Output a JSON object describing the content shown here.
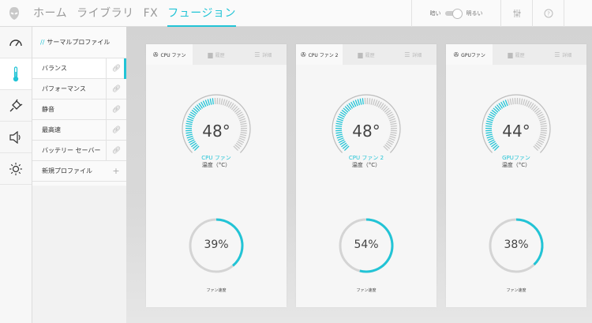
{
  "nav": {
    "items": [
      "ホーム",
      "ライブラリ",
      "FX",
      "フュージョン"
    ],
    "active_index": 3
  },
  "brightness": {
    "dark_label": "暗い",
    "bright_label": "明るい"
  },
  "profiles": {
    "title": "サーマルプロファイル",
    "items": [
      "バランス",
      "パフォーマンス",
      "静音",
      "最高速",
      "バッテリー セーバー",
      "新規プロファイル"
    ],
    "active_index": 0
  },
  "panels": [
    {
      "tabs": [
        "CPU ファン",
        "履歴",
        "詳細"
      ],
      "temp": "48°",
      "temp_value": 48,
      "name": "CPU ファン",
      "unit": "温度（°C）",
      "speed": "39%",
      "speed_value": 39,
      "speed_label": "ファン速度"
    },
    {
      "tabs": [
        "CPU ファン 2",
        "履歴",
        "詳細"
      ],
      "temp": "48°",
      "temp_value": 48,
      "name": "CPU ファン 2",
      "unit": "温度（°C）",
      "speed": "54%",
      "speed_value": 54,
      "speed_label": "ファン速度"
    },
    {
      "tabs": [
        "GPUファン",
        "履歴",
        "詳細"
      ],
      "temp": "44°",
      "temp_value": 44,
      "name": "GPUファン",
      "unit": "温度（°C）",
      "speed": "38%",
      "speed_value": 38,
      "speed_label": "ファン速度"
    }
  ],
  "colors": {
    "accent": "#22c4d6",
    "track": "#d4d4d4"
  },
  "icons": {
    "logo": "alien-head-icon",
    "sidebar": [
      "speedometer-icon",
      "thermometer-icon",
      "plug-icon",
      "speaker-icon",
      "sun-icon"
    ],
    "top_right": [
      "sliders-icon",
      "help-icon"
    ]
  }
}
